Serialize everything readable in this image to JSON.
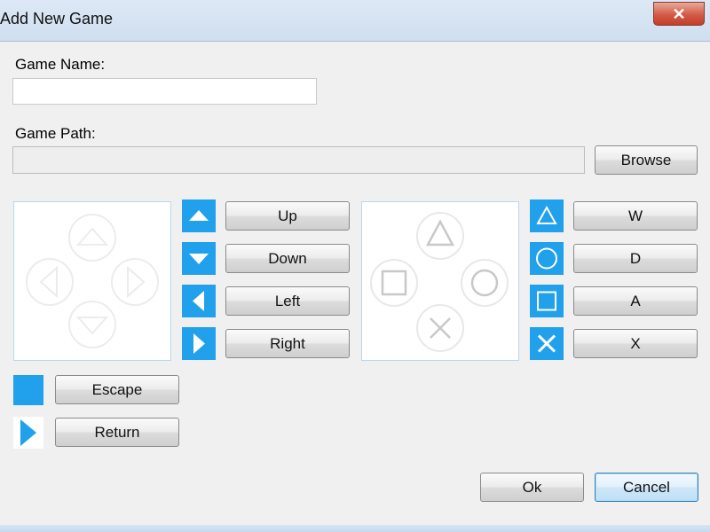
{
  "window": {
    "title": "Add New Game",
    "close_glyph": "✕"
  },
  "fields": {
    "game_name": {
      "label": "Game Name:",
      "value": ""
    },
    "game_path": {
      "label": "Game Path:",
      "value": ""
    },
    "browse_label": "Browse"
  },
  "dpad": {
    "icons": [
      "dpad-up-icon",
      "dpad-down-icon",
      "dpad-left-icon",
      "dpad-right-icon"
    ],
    "bindings": [
      "Up",
      "Down",
      "Left",
      "Right"
    ]
  },
  "face_buttons": {
    "icons": [
      "triangle-icon",
      "circle-icon",
      "square-icon",
      "cross-icon"
    ],
    "bindings": [
      "W",
      "D",
      "A",
      "X"
    ]
  },
  "extra": {
    "escape": {
      "icon": "square-block-icon",
      "label": "Escape"
    },
    "return": {
      "icon": "play-arrow-icon",
      "label": "Return"
    }
  },
  "actions": {
    "ok": "Ok",
    "cancel": "Cancel"
  },
  "colors": {
    "accent": "#21a0ec",
    "title_bar": "#d6e5f4",
    "close_button": "#d25a45"
  }
}
